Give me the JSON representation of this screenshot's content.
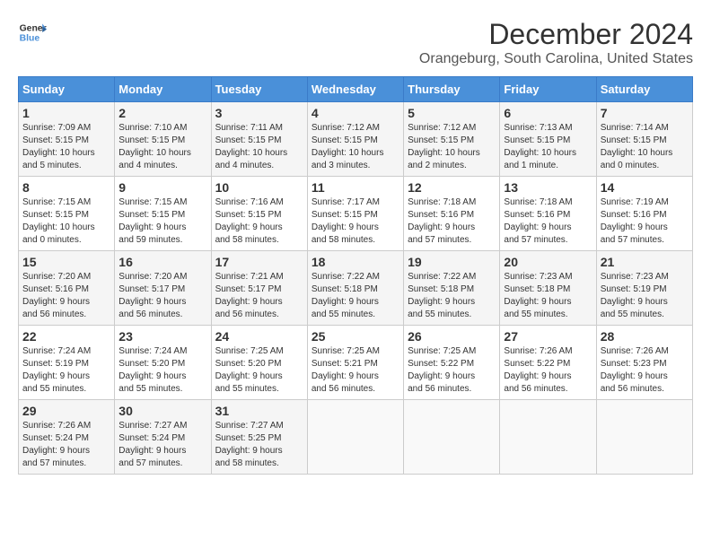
{
  "logo": {
    "line1": "General",
    "line2": "Blue"
  },
  "title": "December 2024",
  "subtitle": "Orangeburg, South Carolina, United States",
  "headers": [
    "Sunday",
    "Monday",
    "Tuesday",
    "Wednesday",
    "Thursday",
    "Friday",
    "Saturday"
  ],
  "weeks": [
    [
      {
        "day": "1",
        "info": "Sunrise: 7:09 AM\nSunset: 5:15 PM\nDaylight: 10 hours\nand 5 minutes."
      },
      {
        "day": "2",
        "info": "Sunrise: 7:10 AM\nSunset: 5:15 PM\nDaylight: 10 hours\nand 4 minutes."
      },
      {
        "day": "3",
        "info": "Sunrise: 7:11 AM\nSunset: 5:15 PM\nDaylight: 10 hours\nand 4 minutes."
      },
      {
        "day": "4",
        "info": "Sunrise: 7:12 AM\nSunset: 5:15 PM\nDaylight: 10 hours\nand 3 minutes."
      },
      {
        "day": "5",
        "info": "Sunrise: 7:12 AM\nSunset: 5:15 PM\nDaylight: 10 hours\nand 2 minutes."
      },
      {
        "day": "6",
        "info": "Sunrise: 7:13 AM\nSunset: 5:15 PM\nDaylight: 10 hours\nand 1 minute."
      },
      {
        "day": "7",
        "info": "Sunrise: 7:14 AM\nSunset: 5:15 PM\nDaylight: 10 hours\nand 0 minutes."
      }
    ],
    [
      {
        "day": "8",
        "info": "Sunrise: 7:15 AM\nSunset: 5:15 PM\nDaylight: 10 hours\nand 0 minutes."
      },
      {
        "day": "9",
        "info": "Sunrise: 7:15 AM\nSunset: 5:15 PM\nDaylight: 9 hours\nand 59 minutes."
      },
      {
        "day": "10",
        "info": "Sunrise: 7:16 AM\nSunset: 5:15 PM\nDaylight: 9 hours\nand 58 minutes."
      },
      {
        "day": "11",
        "info": "Sunrise: 7:17 AM\nSunset: 5:15 PM\nDaylight: 9 hours\nand 58 minutes."
      },
      {
        "day": "12",
        "info": "Sunrise: 7:18 AM\nSunset: 5:16 PM\nDaylight: 9 hours\nand 57 minutes."
      },
      {
        "day": "13",
        "info": "Sunrise: 7:18 AM\nSunset: 5:16 PM\nDaylight: 9 hours\nand 57 minutes."
      },
      {
        "day": "14",
        "info": "Sunrise: 7:19 AM\nSunset: 5:16 PM\nDaylight: 9 hours\nand 57 minutes."
      }
    ],
    [
      {
        "day": "15",
        "info": "Sunrise: 7:20 AM\nSunset: 5:16 PM\nDaylight: 9 hours\nand 56 minutes."
      },
      {
        "day": "16",
        "info": "Sunrise: 7:20 AM\nSunset: 5:17 PM\nDaylight: 9 hours\nand 56 minutes."
      },
      {
        "day": "17",
        "info": "Sunrise: 7:21 AM\nSunset: 5:17 PM\nDaylight: 9 hours\nand 56 minutes."
      },
      {
        "day": "18",
        "info": "Sunrise: 7:22 AM\nSunset: 5:18 PM\nDaylight: 9 hours\nand 55 minutes."
      },
      {
        "day": "19",
        "info": "Sunrise: 7:22 AM\nSunset: 5:18 PM\nDaylight: 9 hours\nand 55 minutes."
      },
      {
        "day": "20",
        "info": "Sunrise: 7:23 AM\nSunset: 5:18 PM\nDaylight: 9 hours\nand 55 minutes."
      },
      {
        "day": "21",
        "info": "Sunrise: 7:23 AM\nSunset: 5:19 PM\nDaylight: 9 hours\nand 55 minutes."
      }
    ],
    [
      {
        "day": "22",
        "info": "Sunrise: 7:24 AM\nSunset: 5:19 PM\nDaylight: 9 hours\nand 55 minutes."
      },
      {
        "day": "23",
        "info": "Sunrise: 7:24 AM\nSunset: 5:20 PM\nDaylight: 9 hours\nand 55 minutes."
      },
      {
        "day": "24",
        "info": "Sunrise: 7:25 AM\nSunset: 5:20 PM\nDaylight: 9 hours\nand 55 minutes."
      },
      {
        "day": "25",
        "info": "Sunrise: 7:25 AM\nSunset: 5:21 PM\nDaylight: 9 hours\nand 56 minutes."
      },
      {
        "day": "26",
        "info": "Sunrise: 7:25 AM\nSunset: 5:22 PM\nDaylight: 9 hours\nand 56 minutes."
      },
      {
        "day": "27",
        "info": "Sunrise: 7:26 AM\nSunset: 5:22 PM\nDaylight: 9 hours\nand 56 minutes."
      },
      {
        "day": "28",
        "info": "Sunrise: 7:26 AM\nSunset: 5:23 PM\nDaylight: 9 hours\nand 56 minutes."
      }
    ],
    [
      {
        "day": "29",
        "info": "Sunrise: 7:26 AM\nSunset: 5:24 PM\nDaylight: 9 hours\nand 57 minutes."
      },
      {
        "day": "30",
        "info": "Sunrise: 7:27 AM\nSunset: 5:24 PM\nDaylight: 9 hours\nand 57 minutes."
      },
      {
        "day": "31",
        "info": "Sunrise: 7:27 AM\nSunset: 5:25 PM\nDaylight: 9 hours\nand 58 minutes."
      },
      {
        "day": "",
        "info": ""
      },
      {
        "day": "",
        "info": ""
      },
      {
        "day": "",
        "info": ""
      },
      {
        "day": "",
        "info": ""
      }
    ]
  ]
}
